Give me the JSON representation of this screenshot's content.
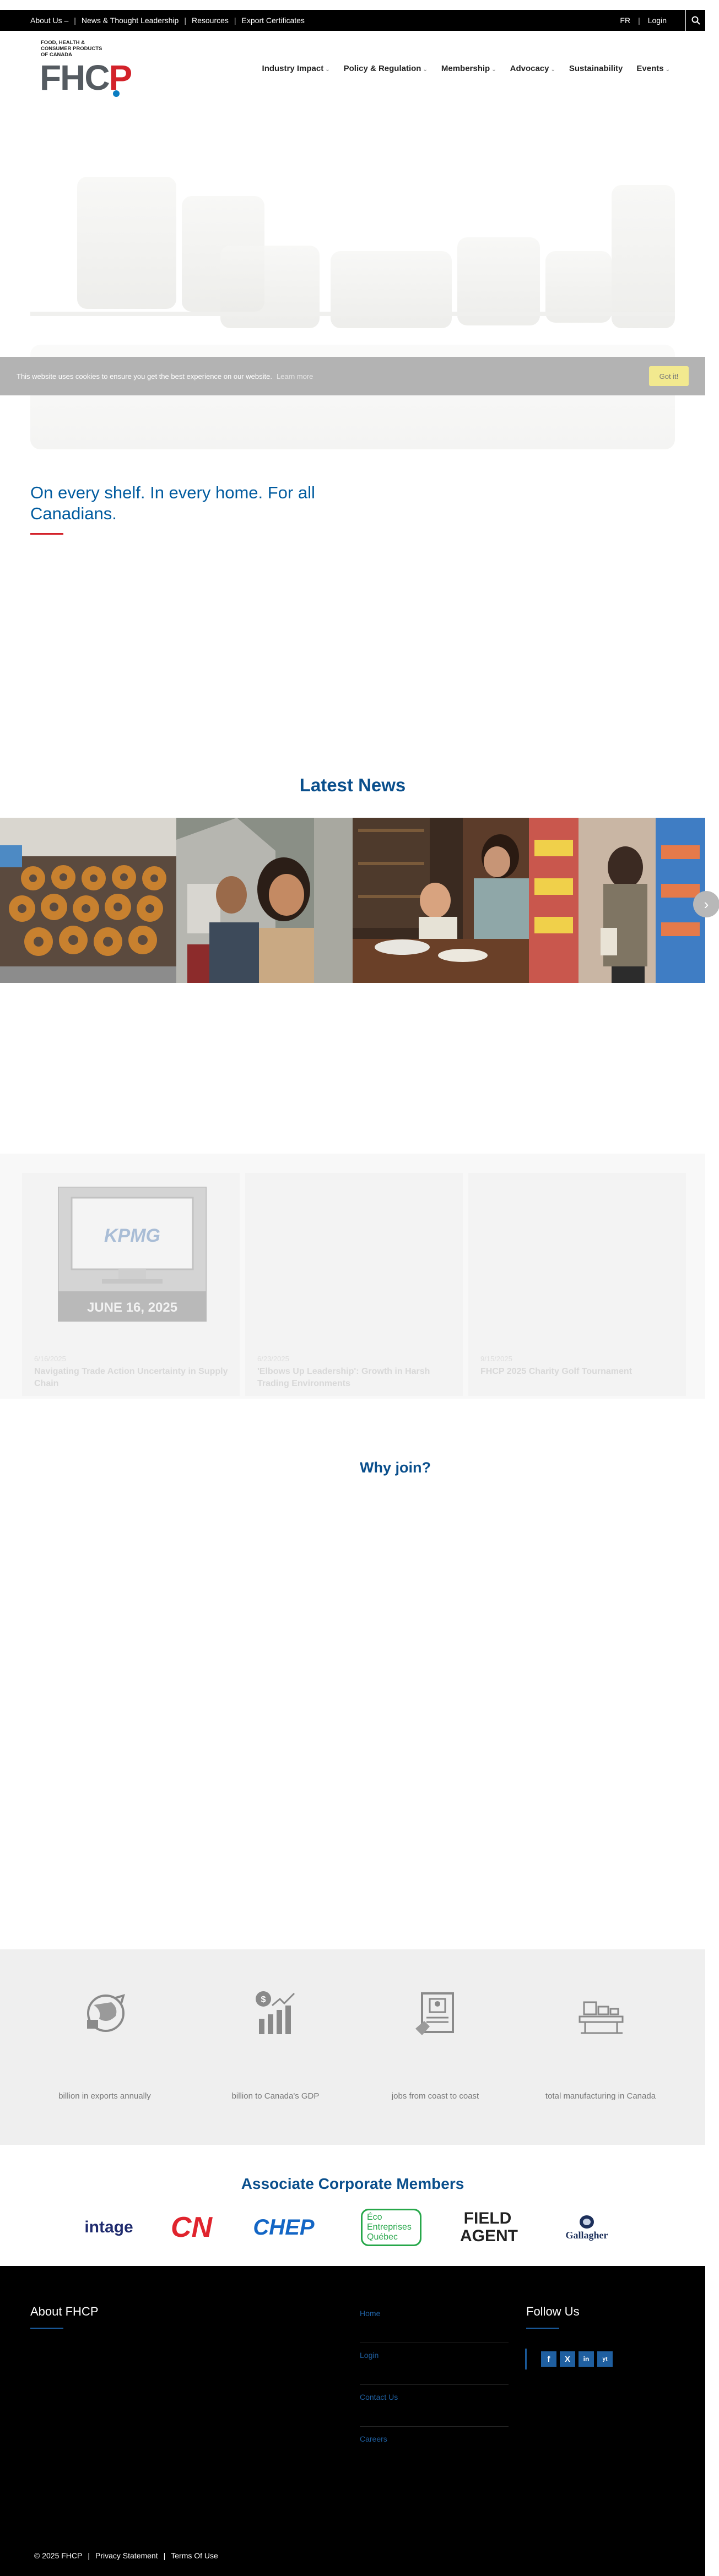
{
  "topbar": {
    "links": [
      "About Us –",
      "News & Thought Leadership",
      "Resources",
      "Export Certificates"
    ],
    "lang": "FR",
    "login": "Login"
  },
  "logo": {
    "line1": "FOOD, HEALTH &",
    "line2": "CONSUMER PRODUCTS",
    "line3": "OF CANADA",
    "mark_left": "FHC",
    "mark_right": "P"
  },
  "nav": [
    "Industry Impact",
    "Policy & Regulation",
    "Membership",
    "Advocacy",
    "Sustainability",
    "Events"
  ],
  "cookie": {
    "message": "This website uses cookies to ensure you get the best experience on our website.",
    "learn_more": "Learn more",
    "button": "Got it!"
  },
  "hero": {
    "tagline": "On every shelf. In every home. For all Canadians."
  },
  "news": {
    "title": "Latest News",
    "next_arrow": "›"
  },
  "events": [
    {
      "date": "6/16/2025",
      "title": "Navigating Trade Action Uncertainty in Supply Chain",
      "image_caption": "KPMG",
      "image_date": "JUNE 16, 2025"
    },
    {
      "date": "6/23/2025",
      "title": "'Elbows Up Leadership': Growth in Harsh Trading Environments"
    },
    {
      "date": "9/15/2025",
      "title": "FHCP 2025 Charity Golf Tournament"
    }
  ],
  "why": {
    "title": "Why join?"
  },
  "stats": [
    {
      "icon": "globe-export-icon",
      "label": "billion in exports annually"
    },
    {
      "icon": "growth-chart-icon",
      "label": "billion to Canada's GDP"
    },
    {
      "icon": "job-profile-icon",
      "label": "jobs from coast to coast"
    },
    {
      "icon": "factory-conveyor-icon",
      "label": "total manufacturing in Canada"
    }
  ],
  "associate": {
    "title": "Associate Corporate Members",
    "logos": [
      "intage",
      "CN",
      "CHEP",
      "Éco Entreprises Québec",
      "FIELD AGENT",
      "Gallagher"
    ]
  },
  "footer": {
    "about_title": "About FHCP",
    "links": [
      "Home",
      "Login",
      "Contact Us",
      "Careers"
    ],
    "follow_title": "Follow Us",
    "social": [
      "f",
      "X",
      "in",
      "yt"
    ],
    "copyright": "© 2025 FHCP",
    "privacy": "Privacy Statement",
    "terms": "Terms Of Use"
  },
  "colors": {
    "brand_blue": "#005b9f",
    "accent_red": "#d3222a",
    "cookie_button": "#f2e98f"
  }
}
